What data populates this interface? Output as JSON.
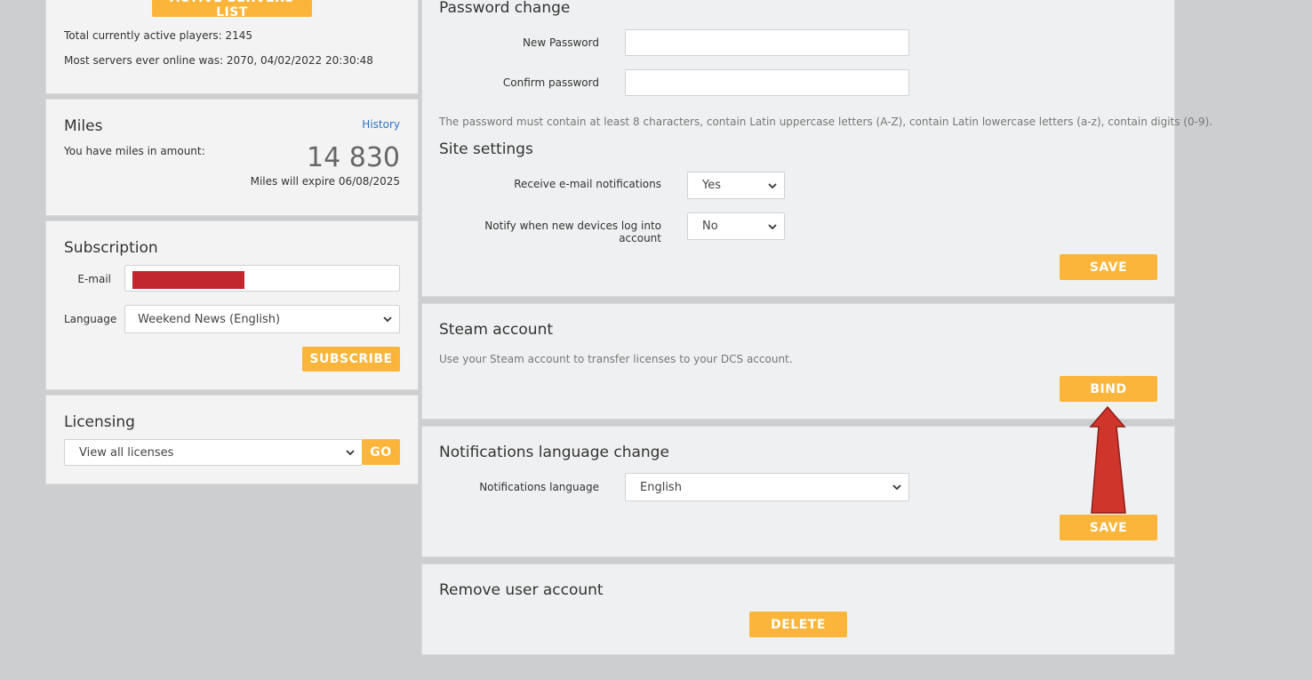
{
  "servers": {
    "button_label": "ACTIVE SERVERS LIST",
    "total_players_label": "Total currently active players:",
    "total_players_value": "2145",
    "max_servers_label": "Most servers ever online was:",
    "max_servers_value": "2070, 04/02/2022 20:30:48"
  },
  "miles": {
    "title": "Miles",
    "history_link": "History",
    "amount_label": "You have miles in amount:",
    "amount_value": "14 830",
    "expire_label": "Miles will expire",
    "expire_value": "06/08/2025"
  },
  "subscription": {
    "title": "Subscription",
    "email_label": "E-mail",
    "email_value": "",
    "language_label": "Language",
    "language_selected": "Weekend News (English)",
    "subscribe_label": "SUBSCRIBE",
    "redaction_color": "#c1272d"
  },
  "licensing": {
    "title": "Licensing",
    "selected": "View all licenses",
    "go_label": "GO"
  },
  "password_change": {
    "title": "Password change",
    "new_label": "New Password",
    "confirm_label": "Confirm password",
    "hint": "The password must contain at least 8 characters, contain Latin uppercase letters (A-Z), contain Latin lowercase letters (a-z), contain digits (0-9)."
  },
  "site_settings": {
    "title": "Site settings",
    "email_notif_label": "Receive e-mail notifications",
    "email_notif_value": "Yes",
    "device_notif_label": "Notify when new devices log into account",
    "device_notif_value": "No",
    "save_label": "SAVE"
  },
  "steam": {
    "title": "Steam account",
    "description": "Use your Steam account to transfer licenses to your DCS account.",
    "bind_label": "BIND"
  },
  "notif_lang": {
    "title": "Notifications language change",
    "label": "Notifications language",
    "selected": "English",
    "save_label": "SAVE"
  },
  "remove_account": {
    "title": "Remove user account",
    "delete_label": "DELETE"
  },
  "colors": {
    "accent": "#fbb53a",
    "arrow": "#d0352b",
    "link": "#2f73c2",
    "background": "#ccced0"
  }
}
